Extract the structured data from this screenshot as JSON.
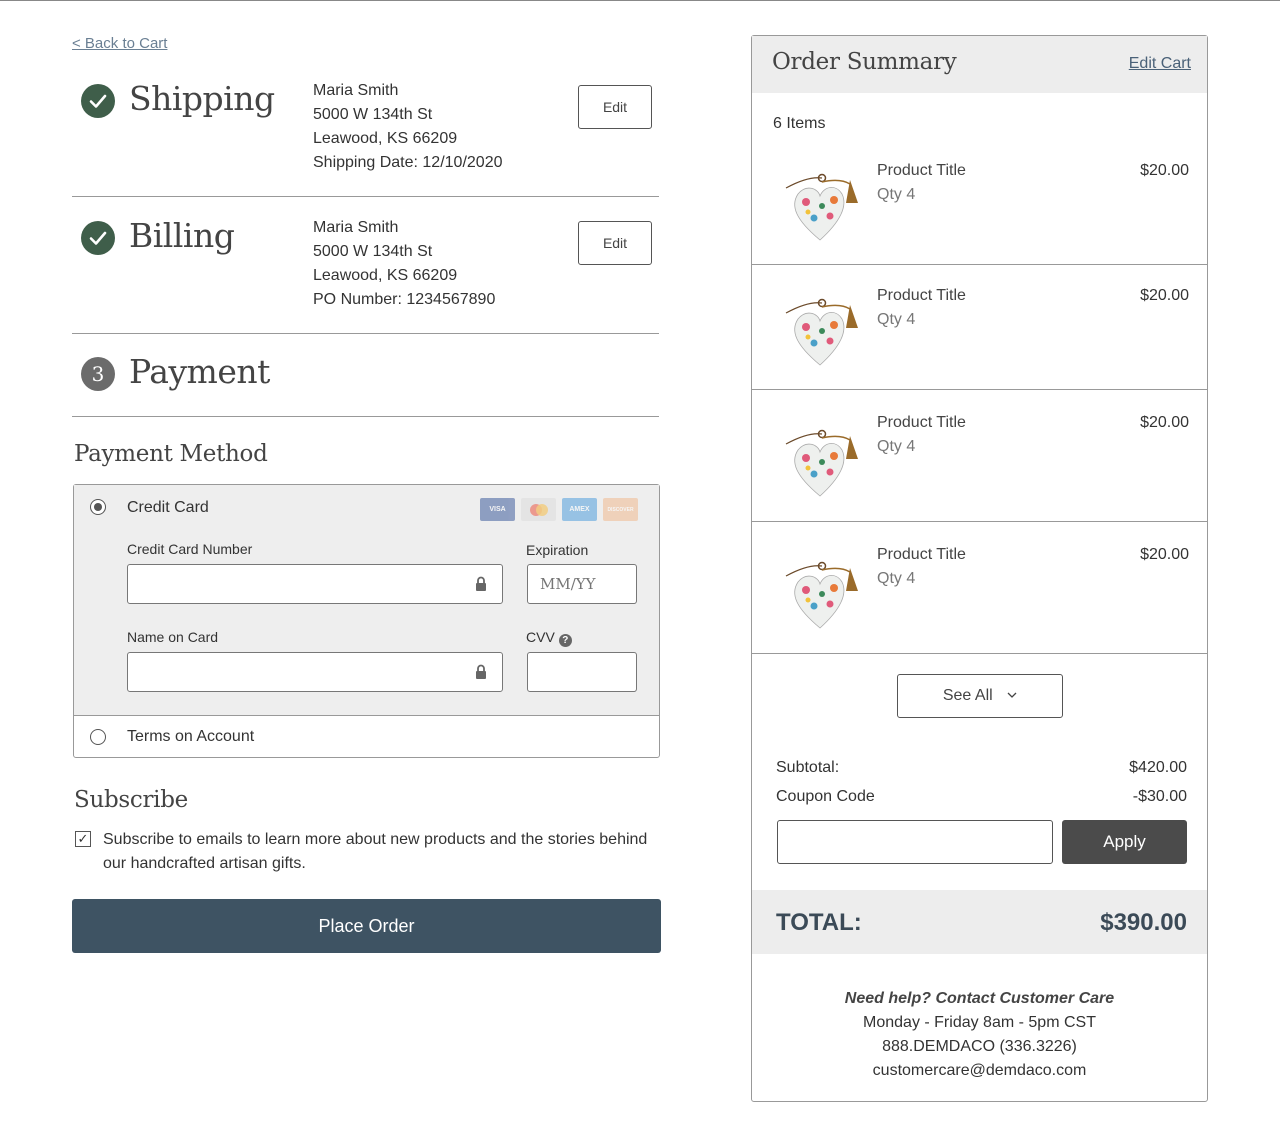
{
  "back_link": "< Back to Cart",
  "shipping": {
    "title": "Shipping",
    "lines": [
      "Maria Smith",
      "5000 W 134th St",
      "Leawood, KS 66209",
      "Shipping Date: 12/10/2020"
    ],
    "edit_label": "Edit"
  },
  "billing": {
    "title": "Billing",
    "lines": [
      "Maria Smith",
      "5000 W 134th St",
      "Leawood, KS 66209",
      "PO Number: 1234567890"
    ],
    "edit_label": "Edit"
  },
  "payment": {
    "step_number": "3",
    "title": "Payment"
  },
  "payment_method": {
    "title": "Payment Method",
    "credit_card_label": "Credit Card",
    "card_logos": [
      "VISA",
      "MC",
      "AMEX",
      "DISCOVER"
    ],
    "card_number_label": "Credit Card Number",
    "expiration_label": "Expiration",
    "expiration_placeholder": "MM/YY",
    "name_label": "Name on Card",
    "cvv_label": "CVV",
    "terms_label": "Terms on Account",
    "selected": "Credit Card"
  },
  "subscribe": {
    "title": "Subscribe",
    "text": "Subscribe to emails to learn more about new products and the stories behind our handcrafted artisan gifts.",
    "checked": true
  },
  "place_order_label": "Place Order",
  "summary": {
    "title": "Order Summary",
    "edit_cart": "Edit Cart",
    "items_count": "6 Items",
    "items": [
      {
        "title": "Product Title",
        "qty": "Qty 4",
        "price": "$20.00"
      },
      {
        "title": "Product Title",
        "qty": "Qty 4",
        "price": "$20.00"
      },
      {
        "title": "Product Title",
        "qty": "Qty 4",
        "price": "$20.00"
      },
      {
        "title": "Product Title",
        "qty": "Qty 4",
        "price": "$20.00"
      }
    ],
    "see_all": "See All",
    "subtotal_label": "Subtotal:",
    "subtotal_value": "$420.00",
    "coupon_label": "Coupon Code",
    "coupon_value": "-$30.00",
    "apply_label": "Apply",
    "total_label": "TOTAL:",
    "total_value": "$390.00"
  },
  "help": {
    "heading": "Need help? Contact Customer Care",
    "hours": "Monday - Friday 8am - 5pm CST",
    "phone": "888.DEMDACO (336.3226)",
    "email": "customercare@demdaco.com"
  },
  "colors": {
    "check_green": "#3f5e4a",
    "place_order": "#3e5363",
    "apply": "#4b4b4b",
    "link": "#4a6178"
  }
}
